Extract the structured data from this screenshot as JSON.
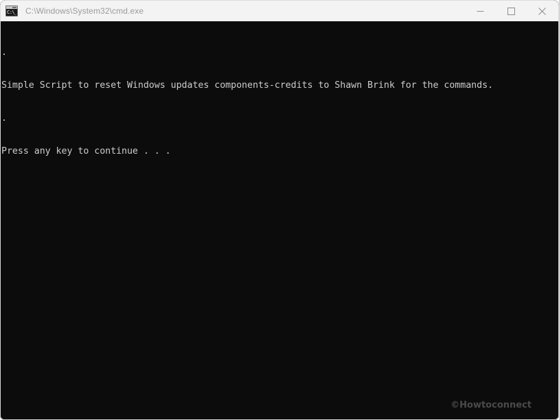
{
  "window": {
    "title": "C:\\Windows\\System32\\cmd.exe",
    "icon": "cmd-icon",
    "icon_prompt": "C:\\_",
    "titlebar_bg": "#f3f3f3",
    "title_color": "#9b9b9b",
    "console_bg": "#0c0c0c",
    "console_fg": "#cccccc"
  },
  "controls": {
    "minimize_label": "Minimize",
    "maximize_label": "Maximize",
    "close_label": "Close"
  },
  "console": {
    "lines": [
      ".",
      "Simple Script to reset Windows updates components-credits to Shawn Brink for the commands.",
      ".",
      "Press any key to continue . . ."
    ]
  },
  "watermark": {
    "text": "©Howtoconnect",
    "color": "#4a4a4a"
  }
}
